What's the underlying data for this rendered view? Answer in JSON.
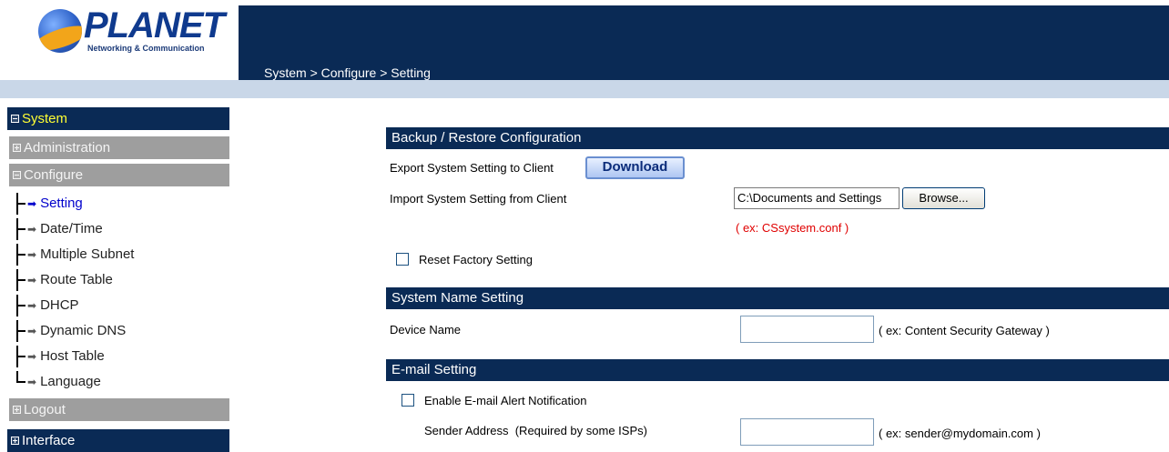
{
  "logo": {
    "name": "PLANET",
    "tagline": "Networking & Communication"
  },
  "header": {
    "breadcrumb": "System > Configure > Setting"
  },
  "sidebar": {
    "system": "System",
    "administration": "Administration",
    "configure": "Configure",
    "items": [
      "Setting",
      "Date/Time",
      "Multiple Subnet",
      "Route Table",
      "DHCP",
      "Dynamic DNS",
      "Host Table",
      "Language"
    ],
    "logout": "Logout",
    "interface": "Interface"
  },
  "backup": {
    "title": "Backup / Restore Configuration",
    "export_label": "Export System Setting to Client",
    "download_button": "Download",
    "import_label": "Import System Setting from Client",
    "file_value": "C:\\Documents and Settings",
    "browse_button": "Browse...",
    "example": "( ex: CSsystem.conf )",
    "reset_label": "Reset Factory Setting"
  },
  "system_name": {
    "title": "System Name Setting",
    "device_label": "Device Name",
    "device_value": "",
    "device_hint": "( ex: Content Security Gateway )"
  },
  "email": {
    "title": "E-mail Setting",
    "enable_label": "Enable E-mail Alert Notification",
    "sender_label": "Sender Address  (Required by some ISPs)",
    "sender_value": "",
    "sender_hint": "( ex: sender@mydomain.com )"
  }
}
